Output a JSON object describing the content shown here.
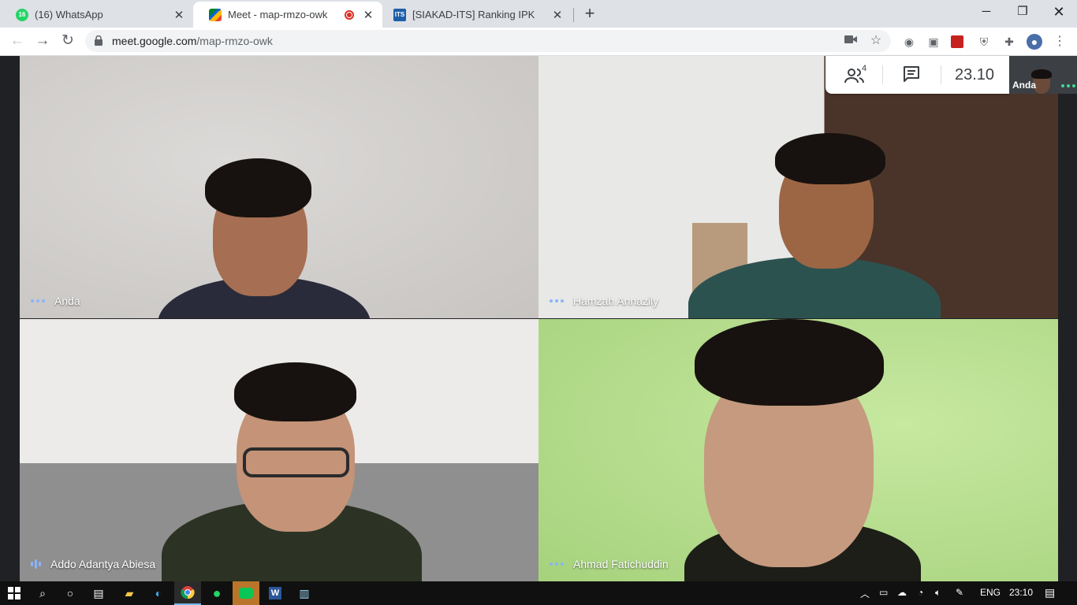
{
  "browser": {
    "tabs": [
      {
        "title": "(16) WhatsApp",
        "badge": "16",
        "favicon": "whatsapp-icon"
      },
      {
        "title": "Meet - map-rmzo-owk",
        "favicon": "google-meet-icon",
        "recording": true
      },
      {
        "title": "[SIAKAD-ITS] Ranking IPK",
        "favicon": "its-icon",
        "favicon_text": "ITS"
      }
    ],
    "new_tab_label": "+",
    "url_host": "meet.google.com",
    "url_path": "/map-rmzo-owk"
  },
  "meet": {
    "participants_count": "4",
    "clock": "23.10",
    "self_label": "Anda",
    "tiles": [
      {
        "name": "Anda",
        "indicator": "dots"
      },
      {
        "name": "Hamzah Annazily",
        "indicator": "dots"
      },
      {
        "name": "Addo Adantya Abiesa",
        "indicator": "speaking"
      },
      {
        "name": "Ahmad Fatichuddin",
        "indicator": "dots"
      }
    ]
  },
  "taskbar": {
    "language": "ENG",
    "time": "23:10"
  },
  "colors": {
    "tab_strip": "#dee1e6",
    "meet_background": "#202124",
    "indicator_blue": "#8ab4f8",
    "taskbar": "#101010"
  }
}
